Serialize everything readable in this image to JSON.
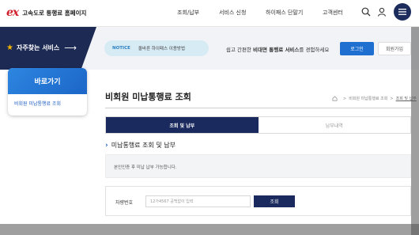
{
  "header": {
    "logo_mark": "ex",
    "logo_text": "고속도로 통행료 홈페이지",
    "nav": [
      {
        "label": "조회/납부"
      },
      {
        "label": "서비스 신청"
      },
      {
        "label": "하이패스 단말기"
      },
      {
        "label": "고객센터"
      }
    ],
    "icons": {
      "search": "search-icon",
      "user": "user-icon",
      "menu": "hamburger-menu-icon"
    }
  },
  "banner": {
    "favorites_label": "자주찾는 서비스",
    "notice_tag": "NOTICE",
    "notice_text": "올바른 하이패스 이용방법",
    "promo_prefix": "쉽고 간편한 ",
    "promo_bold": "비대면 통행료 서비스",
    "promo_suffix": "를 경험하세요",
    "login_label": "로그인",
    "join_label": "회원가입"
  },
  "side": {
    "title": "바로가기",
    "items": [
      {
        "label": "비회원 미납통행료 조회"
      }
    ]
  },
  "main": {
    "title": "비회원 미납통행료 조회",
    "breadcrumb": [
      "비회원 미납통행료 조회",
      "조회 및 납부"
    ],
    "tabs": [
      {
        "label": "조회 및 납부",
        "active": true
      },
      {
        "label": "납부내역",
        "active": false
      }
    ],
    "section_title": "미납통행료 조회 및 납부",
    "info_text": "본인인증 후 미납 납부 가능합니다.",
    "form": {
      "label": "차량번호",
      "placeholder": "12가4567 공백없이 입력",
      "value": "",
      "button_label": "조회"
    }
  },
  "colors": {
    "navy": "#1a2a5e",
    "brand_red": "#d0202c",
    "primary_blue": "#1f6fd0",
    "notice_bg": "#d7ebf5"
  }
}
